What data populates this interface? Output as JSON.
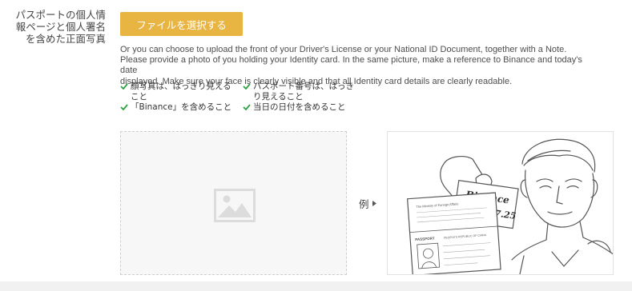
{
  "field": {
    "label_lines": [
      "パスポートの個人情",
      "報ページと個人署名",
      "を含めた正面写真"
    ]
  },
  "upload": {
    "button_label": "ファイルを選択する"
  },
  "instructions": {
    "line1": "Or you can choose to upload the front of your Driver's License or your National ID Document, together with a Note.",
    "line2": "Please provide a photo of you holding your Identity card. In the same picture, make a reference to Binance and today's date",
    "line3": "displayed. Make sure your face is clearly visible and that all Identity card details are clearly readable."
  },
  "checklist": {
    "icon": "check-icon",
    "color": "#2ea043",
    "items": [
      {
        "lines": [
          "顔写真は、はっきり見える",
          "こと"
        ]
      },
      {
        "lines": [
          "パスポート番号は、はっき",
          "り見えること"
        ]
      },
      {
        "lines": [
          "「Binance」を含めること"
        ]
      },
      {
        "lines": [
          "当日の日付を含めること"
        ]
      }
    ]
  },
  "upload_area": {
    "icon": "image-placeholder-icon"
  },
  "example": {
    "label": "例",
    "note_brand": "Binance",
    "note_date": "2017.07.25",
    "passport_word": "PASSPORT",
    "passport_header": "PEOPLE'S REPUBLIC OF CHINA",
    "passport_ministry": "The Ministry of Foreign Affairs"
  },
  "colors": {
    "accent": "#e8b542",
    "text": "#333333",
    "border": "#cfcfcf"
  }
}
